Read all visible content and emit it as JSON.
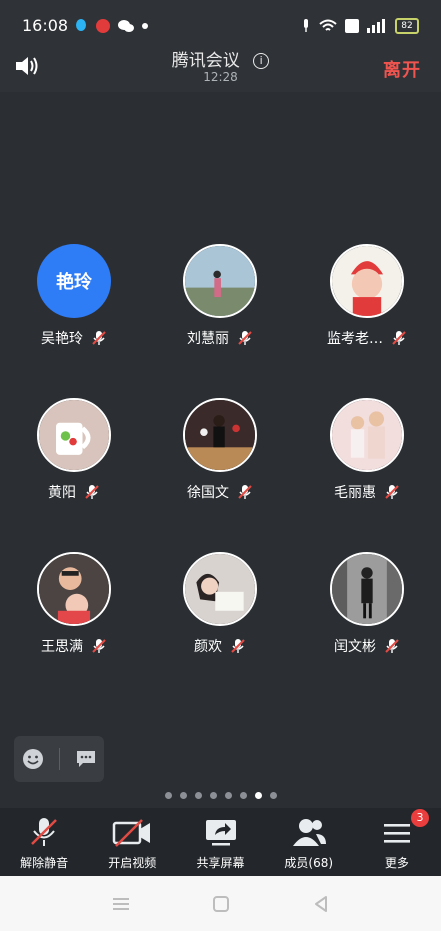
{
  "status_bar": {
    "time": "16:08",
    "battery": "82"
  },
  "header": {
    "title": "腾讯会议",
    "info_glyph": "i",
    "duration": "12:28",
    "leave_label": "离开"
  },
  "members": [
    {
      "name": "吴艳玲",
      "avatar_text": "艳玲",
      "avatar_color": "#2f7cf7",
      "muted": true
    },
    {
      "name": "刘慧丽",
      "avatar_text": "",
      "muted": true
    },
    {
      "name": "监考老…",
      "avatar_text": "",
      "muted": true
    },
    {
      "name": "黄阳",
      "avatar_text": "",
      "muted": true
    },
    {
      "name": "徐国文",
      "avatar_text": "",
      "muted": true
    },
    {
      "name": "毛丽惠",
      "avatar_text": "",
      "muted": true
    },
    {
      "name": "王思满",
      "avatar_text": "",
      "muted": true
    },
    {
      "name": "颜欢",
      "avatar_text": "",
      "muted": true
    },
    {
      "name": "闰文彬",
      "avatar_text": "",
      "muted": true
    }
  ],
  "page_indicator": {
    "count": 8,
    "active": 7
  },
  "toolbar": {
    "unmute": "解除静音",
    "start_video": "开启视频",
    "share_screen": "共享屏幕",
    "members": "成员(68)",
    "more": "更多",
    "more_badge": "3"
  },
  "icons": {
    "speaker": "speaker-icon",
    "emoji": "emoji-icon",
    "chat": "chat-icon"
  },
  "colors": {
    "accent_blue": "#2f7cf7",
    "leave_red": "#f0544f",
    "badge_red": "#ea3d3d"
  }
}
